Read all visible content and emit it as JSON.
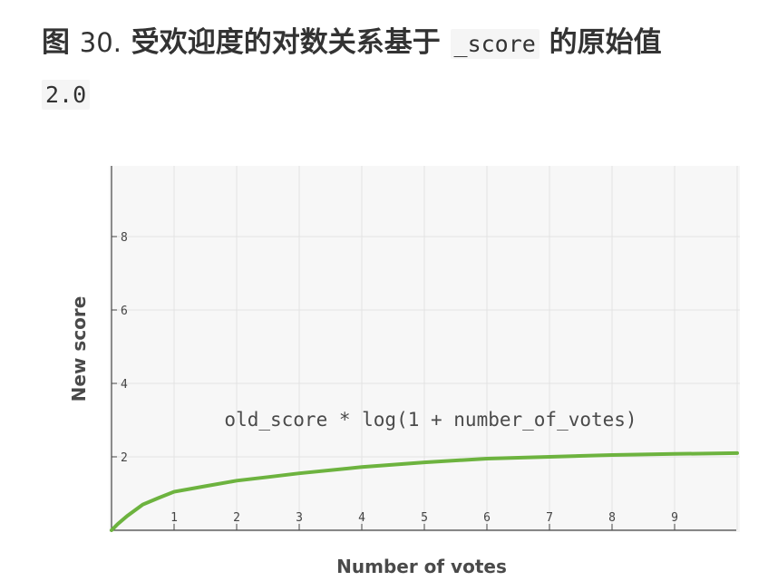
{
  "heading": {
    "prefix": "图 ",
    "number": "30.",
    "text_before_code": " 受欢迎度的对数关系基于 ",
    "code": "_score",
    "text_after_code": " 的原始值",
    "code_value": "2.0"
  },
  "chart_data": {
    "type": "line",
    "title": "",
    "xlabel": "Number of votes",
    "ylabel": "New score",
    "annotation": "old_score * log(1 + number_of_votes)",
    "xlim": [
      0,
      10
    ],
    "ylim": [
      0,
      10
    ],
    "x_ticks": [
      "1",
      "2",
      "3",
      "4",
      "5",
      "6",
      "7",
      "8",
      "9"
    ],
    "y_ticks": [
      "2",
      "4",
      "6",
      "8"
    ],
    "grid": true,
    "line_color": "#6db33f",
    "series": [
      {
        "x": [
          0,
          0.1,
          0.25,
          0.5,
          0.75,
          1,
          1.5,
          2,
          2.5,
          3,
          4,
          5,
          6,
          7,
          8,
          9,
          10
        ],
        "values": [
          0,
          0.17,
          0.39,
          0.7,
          0.88,
          1.05,
          1.2,
          1.35,
          1.45,
          1.55,
          1.72,
          1.85,
          1.95,
          2.0,
          2.05,
          2.08,
          2.1
        ]
      }
    ]
  }
}
